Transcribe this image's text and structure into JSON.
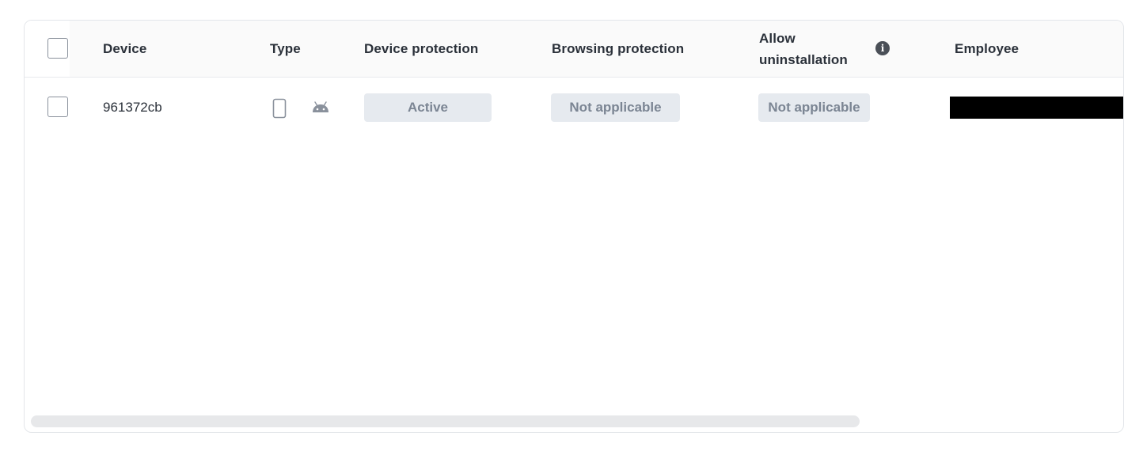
{
  "table": {
    "columns": {
      "device": "Device",
      "type": "Type",
      "device_protection": "Device protection",
      "browsing_protection": "Browsing protection",
      "allow_uninstallation_line1": "Allow",
      "allow_uninstallation_line2": "uninstallation",
      "employee": "Employee"
    },
    "rows": [
      {
        "device": "961372cb",
        "type_icons": [
          "mobile-phone-icon",
          "android-icon"
        ],
        "device_protection": "Active",
        "browsing_protection": "Not applicable",
        "allow_uninstallation": "Not applicable",
        "employee_redacted": true
      }
    ]
  },
  "colors": {
    "header_bg": "#fafafa",
    "badge_bg": "#e6eaef",
    "badge_text": "#7b8593",
    "text": "#2b313a"
  }
}
